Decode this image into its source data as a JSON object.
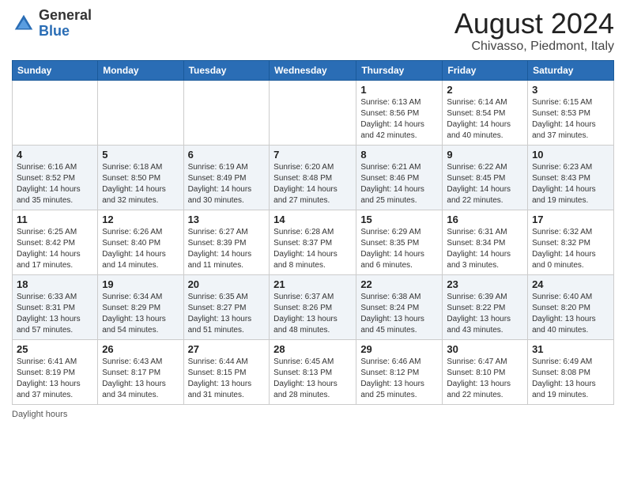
{
  "header": {
    "logo_general": "General",
    "logo_blue": "Blue",
    "month_year": "August 2024",
    "location": "Chivasso, Piedmont, Italy"
  },
  "weekdays": [
    "Sunday",
    "Monday",
    "Tuesday",
    "Wednesday",
    "Thursday",
    "Friday",
    "Saturday"
  ],
  "weeks": [
    [
      {
        "day": "",
        "info": ""
      },
      {
        "day": "",
        "info": ""
      },
      {
        "day": "",
        "info": ""
      },
      {
        "day": "",
        "info": ""
      },
      {
        "day": "1",
        "info": "Sunrise: 6:13 AM\nSunset: 8:56 PM\nDaylight: 14 hours\nand 42 minutes."
      },
      {
        "day": "2",
        "info": "Sunrise: 6:14 AM\nSunset: 8:54 PM\nDaylight: 14 hours\nand 40 minutes."
      },
      {
        "day": "3",
        "info": "Sunrise: 6:15 AM\nSunset: 8:53 PM\nDaylight: 14 hours\nand 37 minutes."
      }
    ],
    [
      {
        "day": "4",
        "info": "Sunrise: 6:16 AM\nSunset: 8:52 PM\nDaylight: 14 hours\nand 35 minutes."
      },
      {
        "day": "5",
        "info": "Sunrise: 6:18 AM\nSunset: 8:50 PM\nDaylight: 14 hours\nand 32 minutes."
      },
      {
        "day": "6",
        "info": "Sunrise: 6:19 AM\nSunset: 8:49 PM\nDaylight: 14 hours\nand 30 minutes."
      },
      {
        "day": "7",
        "info": "Sunrise: 6:20 AM\nSunset: 8:48 PM\nDaylight: 14 hours\nand 27 minutes."
      },
      {
        "day": "8",
        "info": "Sunrise: 6:21 AM\nSunset: 8:46 PM\nDaylight: 14 hours\nand 25 minutes."
      },
      {
        "day": "9",
        "info": "Sunrise: 6:22 AM\nSunset: 8:45 PM\nDaylight: 14 hours\nand 22 minutes."
      },
      {
        "day": "10",
        "info": "Sunrise: 6:23 AM\nSunset: 8:43 PM\nDaylight: 14 hours\nand 19 minutes."
      }
    ],
    [
      {
        "day": "11",
        "info": "Sunrise: 6:25 AM\nSunset: 8:42 PM\nDaylight: 14 hours\nand 17 minutes."
      },
      {
        "day": "12",
        "info": "Sunrise: 6:26 AM\nSunset: 8:40 PM\nDaylight: 14 hours\nand 14 minutes."
      },
      {
        "day": "13",
        "info": "Sunrise: 6:27 AM\nSunset: 8:39 PM\nDaylight: 14 hours\nand 11 minutes."
      },
      {
        "day": "14",
        "info": "Sunrise: 6:28 AM\nSunset: 8:37 PM\nDaylight: 14 hours\nand 8 minutes."
      },
      {
        "day": "15",
        "info": "Sunrise: 6:29 AM\nSunset: 8:35 PM\nDaylight: 14 hours\nand 6 minutes."
      },
      {
        "day": "16",
        "info": "Sunrise: 6:31 AM\nSunset: 8:34 PM\nDaylight: 14 hours\nand 3 minutes."
      },
      {
        "day": "17",
        "info": "Sunrise: 6:32 AM\nSunset: 8:32 PM\nDaylight: 14 hours\nand 0 minutes."
      }
    ],
    [
      {
        "day": "18",
        "info": "Sunrise: 6:33 AM\nSunset: 8:31 PM\nDaylight: 13 hours\nand 57 minutes."
      },
      {
        "day": "19",
        "info": "Sunrise: 6:34 AM\nSunset: 8:29 PM\nDaylight: 13 hours\nand 54 minutes."
      },
      {
        "day": "20",
        "info": "Sunrise: 6:35 AM\nSunset: 8:27 PM\nDaylight: 13 hours\nand 51 minutes."
      },
      {
        "day": "21",
        "info": "Sunrise: 6:37 AM\nSunset: 8:26 PM\nDaylight: 13 hours\nand 48 minutes."
      },
      {
        "day": "22",
        "info": "Sunrise: 6:38 AM\nSunset: 8:24 PM\nDaylight: 13 hours\nand 45 minutes."
      },
      {
        "day": "23",
        "info": "Sunrise: 6:39 AM\nSunset: 8:22 PM\nDaylight: 13 hours\nand 43 minutes."
      },
      {
        "day": "24",
        "info": "Sunrise: 6:40 AM\nSunset: 8:20 PM\nDaylight: 13 hours\nand 40 minutes."
      }
    ],
    [
      {
        "day": "25",
        "info": "Sunrise: 6:41 AM\nSunset: 8:19 PM\nDaylight: 13 hours\nand 37 minutes."
      },
      {
        "day": "26",
        "info": "Sunrise: 6:43 AM\nSunset: 8:17 PM\nDaylight: 13 hours\nand 34 minutes."
      },
      {
        "day": "27",
        "info": "Sunrise: 6:44 AM\nSunset: 8:15 PM\nDaylight: 13 hours\nand 31 minutes."
      },
      {
        "day": "28",
        "info": "Sunrise: 6:45 AM\nSunset: 8:13 PM\nDaylight: 13 hours\nand 28 minutes."
      },
      {
        "day": "29",
        "info": "Sunrise: 6:46 AM\nSunset: 8:12 PM\nDaylight: 13 hours\nand 25 minutes."
      },
      {
        "day": "30",
        "info": "Sunrise: 6:47 AM\nSunset: 8:10 PM\nDaylight: 13 hours\nand 22 minutes."
      },
      {
        "day": "31",
        "info": "Sunrise: 6:49 AM\nSunset: 8:08 PM\nDaylight: 13 hours\nand 19 minutes."
      }
    ]
  ],
  "footer": {
    "daylight_label": "Daylight hours"
  }
}
